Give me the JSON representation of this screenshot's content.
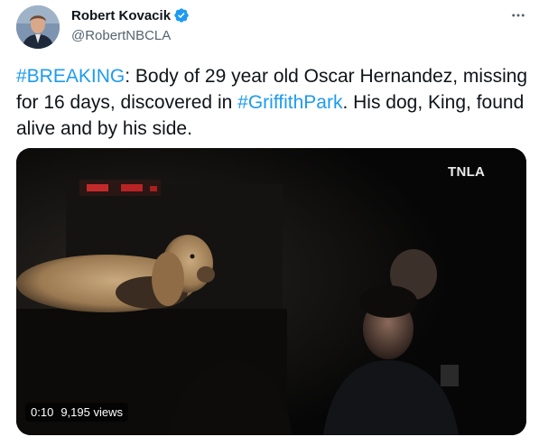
{
  "author": {
    "name": "Robert Kovacik",
    "handle": "@RobertNBCLA"
  },
  "tweet": {
    "segments": [
      {
        "text": "#BREAKING",
        "type": "hashtag"
      },
      {
        "text": ":  Body of 29 year old Oscar Hernandez, missing for 16 days, discovered in ",
        "type": "text"
      },
      {
        "text": "#GriffithPark",
        "type": "hashtag"
      },
      {
        "text": ".  His dog, King, found alive and by his side.",
        "type": "text"
      }
    ]
  },
  "media": {
    "watermark": "TNLA",
    "time": "0:10",
    "views": "9,195 views"
  },
  "colors": {
    "link": "#1d9bf0",
    "verified": "#1d9bf0",
    "secondary_text": "#536471"
  },
  "icons": {
    "verified": "verified-badge-icon",
    "more": "more-options-icon"
  }
}
